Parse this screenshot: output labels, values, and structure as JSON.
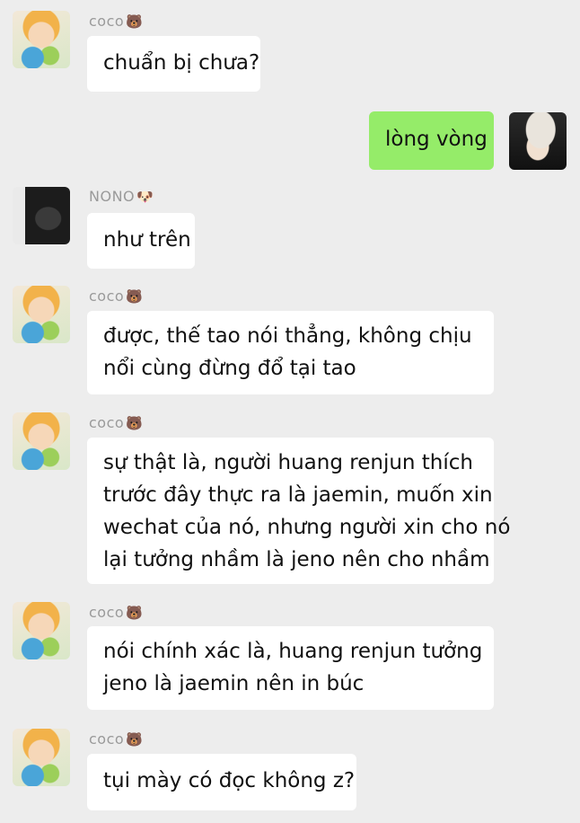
{
  "messages": [
    {
      "sender": "coco",
      "emoji": "🐻",
      "lines": [
        "chuẩn bị chưa?"
      ]
    },
    {
      "sender": "self",
      "lines": [
        "lòng vòng"
      ]
    },
    {
      "sender": "NONO",
      "emoji": "🐶",
      "lines": [
        "như trên"
      ]
    },
    {
      "sender": "coco",
      "emoji": "🐻",
      "lines": [
        "được, thế tao nói thẳng, không chịu",
        "nổi cùng đừng đổ tại tao"
      ]
    },
    {
      "sender": "coco",
      "emoji": "🐻",
      "lines": [
        "sự thật là, người huang renjun thích",
        "trước đây thực ra là jaemin, muốn xin",
        "wechat của nó, nhưng người xin cho nó",
        "lại tưởng nhầm là jeno nên cho nhầm"
      ]
    },
    {
      "sender": "coco",
      "emoji": "🐻",
      "lines": [
        "nói chính xác là, huang renjun tưởng",
        "jeno là jaemin nên in búc"
      ]
    },
    {
      "sender": "coco",
      "emoji": "🐻",
      "lines": [
        "tụi mày có đọc không z?"
      ]
    }
  ],
  "colors": {
    "background": "#ededed",
    "incoming_bubble": "#ffffff",
    "outgoing_bubble": "#95ec69",
    "name_text": "#9a9a9a"
  }
}
